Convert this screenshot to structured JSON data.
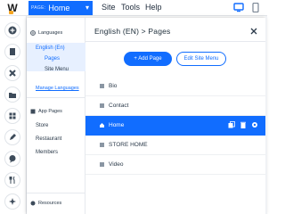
{
  "app": {
    "logo_letter": "W",
    "page_dropdown": {
      "prefix": "PAGE:",
      "value": "Home"
    },
    "menu": [
      "Site",
      "Tools",
      "Help"
    ]
  },
  "panel": {
    "title": "English (EN) > Pages",
    "buttons": {
      "add_page": "+ Add Page",
      "edit_site_menu": "Edit Site Menu"
    },
    "sidebar": {
      "languages_label": "Languages",
      "language": "English (En)",
      "language_items": [
        "Pages",
        "Site Menu"
      ],
      "manage_languages": "Manage Languages",
      "app_pages_label": "App Pages",
      "app_pages": [
        "Store",
        "Restaurant",
        "Members"
      ],
      "resources_label": "Resources"
    },
    "pages": [
      "Bio",
      "Contact",
      "Home",
      "STORE HOME",
      "Video"
    ],
    "selected_page": "Home"
  },
  "colors": {
    "accent": "#116dff",
    "selected_bg": "#e7f0ff",
    "logo_dot": "#f6a623"
  }
}
